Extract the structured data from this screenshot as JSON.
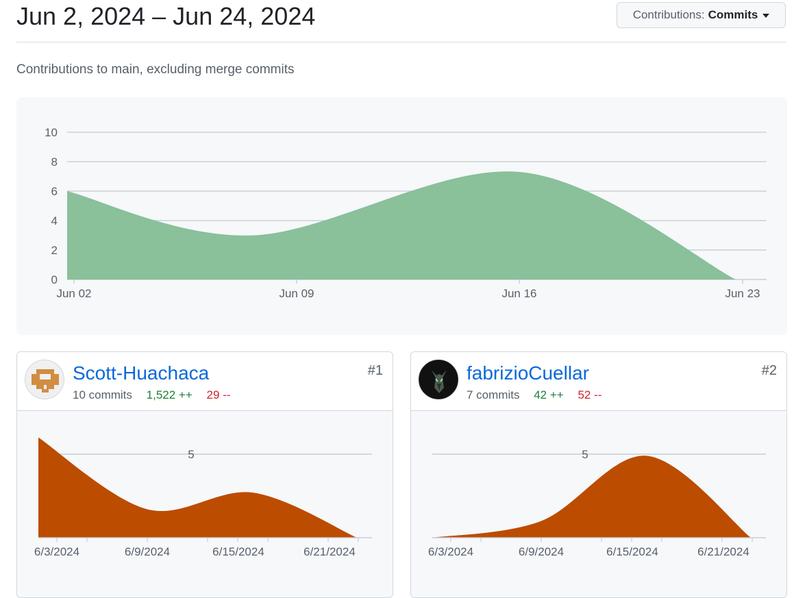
{
  "header": {
    "date_range": "Jun 2, 2024 – Jun 24, 2024",
    "dropdown_prefix": "Contributions:",
    "dropdown_value": "Commits"
  },
  "subtitle": "Contributions to main, excluding merge commits",
  "colors": {
    "main_area": "#8ac09a",
    "contributor_area": "#bc4c00",
    "additions": "#1a7f37",
    "deletions": "#cf222e",
    "link": "#0969da"
  },
  "chart_data": [
    {
      "type": "area",
      "x_ticks": [
        "Jun 02",
        "Jun 09",
        "Jun 16",
        "Jun 23"
      ],
      "y_ticks": [
        0,
        2,
        4,
        6,
        8,
        10
      ],
      "ylim": [
        0,
        10
      ],
      "grid": true,
      "series": [
        {
          "x": [
            "Jun 02",
            "Jun 09",
            "Jun 16",
            "Jun 23"
          ],
          "values": [
            6,
            3,
            7.3,
            0
          ]
        }
      ]
    },
    {
      "type": "area",
      "x_ticks": [
        "6/3/2024",
        "6/9/2024",
        "6/15/2024",
        "6/21/2024"
      ],
      "y_ticks": [
        5
      ],
      "ylim": [
        0,
        5
      ],
      "grid": true,
      "series": [
        {
          "x": [
            "6/2/2024",
            "6/9/2024",
            "6/16/2024",
            "6/23/2024"
          ],
          "values": [
            6,
            1.7,
            2.7,
            0
          ]
        }
      ]
    },
    {
      "type": "area",
      "x_ticks": [
        "6/3/2024",
        "6/9/2024",
        "6/15/2024",
        "6/21/2024"
      ],
      "y_ticks": [
        5
      ],
      "ylim": [
        0,
        5
      ],
      "grid": true,
      "series": [
        {
          "x": [
            "6/2/2024",
            "6/9/2024",
            "6/16/2024",
            "6/23/2024"
          ],
          "values": [
            0,
            1,
            4.9,
            0
          ]
        }
      ]
    }
  ],
  "contributors": [
    {
      "name": "Scott-Huachaca",
      "commits": "10 commits",
      "additions": "1,522 ++",
      "deletions": "29 --",
      "rank": "#1"
    },
    {
      "name": "fabrizioCuellar",
      "commits": "7 commits",
      "additions": "42 ++",
      "deletions": "52 --",
      "rank": "#2"
    }
  ]
}
